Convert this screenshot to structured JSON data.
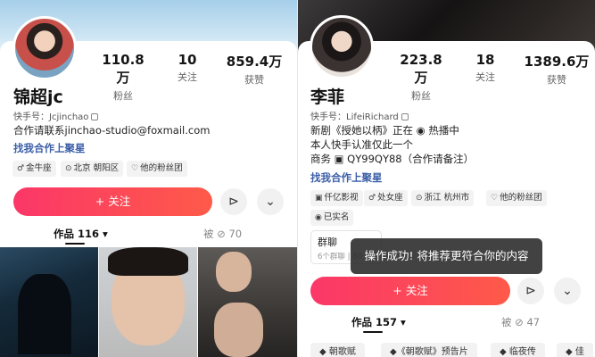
{
  "left_profile": {
    "stats": [
      {
        "value": "110.8万",
        "label": "粉丝"
      },
      {
        "value": "10",
        "label": "关注"
      },
      {
        "value": "859.4万",
        "label": "获赞"
      }
    ],
    "name": "锦超jc",
    "uid": "快手号：Jcjinchao",
    "bio": [
      "合作请联系jinchao-studio@foxmail.com"
    ],
    "link": "找我合作上聚星",
    "tags": [
      {
        "icon": "♂",
        "text": "金牛座"
      },
      {
        "icon": "⊙",
        "text": "北京 朝阳区"
      },
      {
        "icon": "♡",
        "text": "他的粉丝团"
      }
    ],
    "follow_label": "+ 关注",
    "works_tab": "作品 116 ▾",
    "liked_tab": "被 ⊘ 70"
  },
  "right_profile": {
    "stats": [
      {
        "value": "223.8万",
        "label": "粉丝"
      },
      {
        "value": "18",
        "label": "关注"
      },
      {
        "value": "1389.6万",
        "label": "获赞"
      }
    ],
    "name": "李菲",
    "uid": "快手号：LifeiRichard",
    "bio": [
      "新剧《授她以柄》正在 ◉ 热播中",
      "本人快手认准仅此一个",
      "商务 ▣ QY99QY88（合作请备注）"
    ],
    "link": "找我合作上聚星",
    "tags": [
      {
        "icon": "▣",
        "text": "仟亿影视"
      },
      {
        "icon": "♂",
        "text": "处女座"
      },
      {
        "icon": "⊙",
        "text": "浙江 杭州市"
      },
      {
        "icon": "♡",
        "text": "他的粉丝团"
      }
    ],
    "tag_verified": {
      "icon": "◉",
      "text": "已实名"
    },
    "group": {
      "title": "群聊",
      "subtitle": "6个群聊 | 80"
    },
    "follow_label": "+ 关注",
    "works_tab": "作品 157 ▾",
    "liked_tab": "被 ⊘ 47",
    "chips": [
      "◆ 朝歌赋",
      "◆《朝歌赋》预告片",
      "◆ 临夜传",
      "◆ 佳"
    ]
  },
  "toast": "操作成功! 将推荐更符合你的内容",
  "icons": {
    "share": "share-icon",
    "more": "chevron-down-icon"
  },
  "colors": {
    "follow_start": "#fb3768",
    "follow_end": "#fe5a49",
    "link": "#3b5ea8",
    "toast_bg": "#282828"
  }
}
